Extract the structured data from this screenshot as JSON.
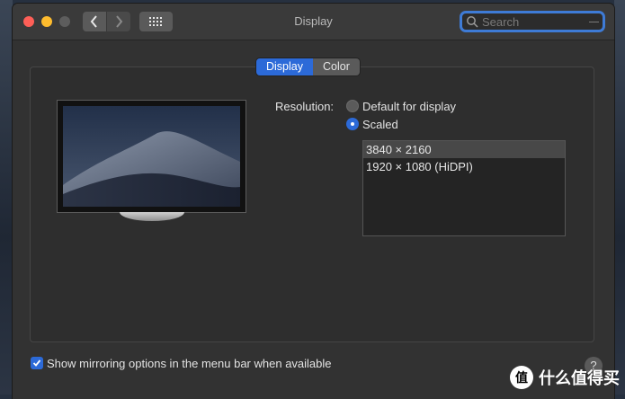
{
  "window": {
    "title": "Display"
  },
  "search": {
    "placeholder": "Search"
  },
  "tabs": [
    {
      "label": "Display",
      "active": true
    },
    {
      "label": "Color",
      "active": false
    }
  ],
  "resolution": {
    "label": "Resolution:",
    "options": [
      {
        "label": "Default for display",
        "selected": false
      },
      {
        "label": "Scaled",
        "selected": true
      }
    ],
    "scaled_list": [
      {
        "label": "3840 × 2160",
        "selected": true
      },
      {
        "label": "1920 × 1080 (HiDPI)",
        "selected": false
      }
    ]
  },
  "mirroring": {
    "label": "Show mirroring options in the menu bar when available",
    "checked": true
  },
  "help": {
    "label": "?"
  },
  "watermark": {
    "badge": "值",
    "text": "什么值得买"
  },
  "colors": {
    "accent": "#2c6ad8",
    "window_bg": "#323232"
  }
}
